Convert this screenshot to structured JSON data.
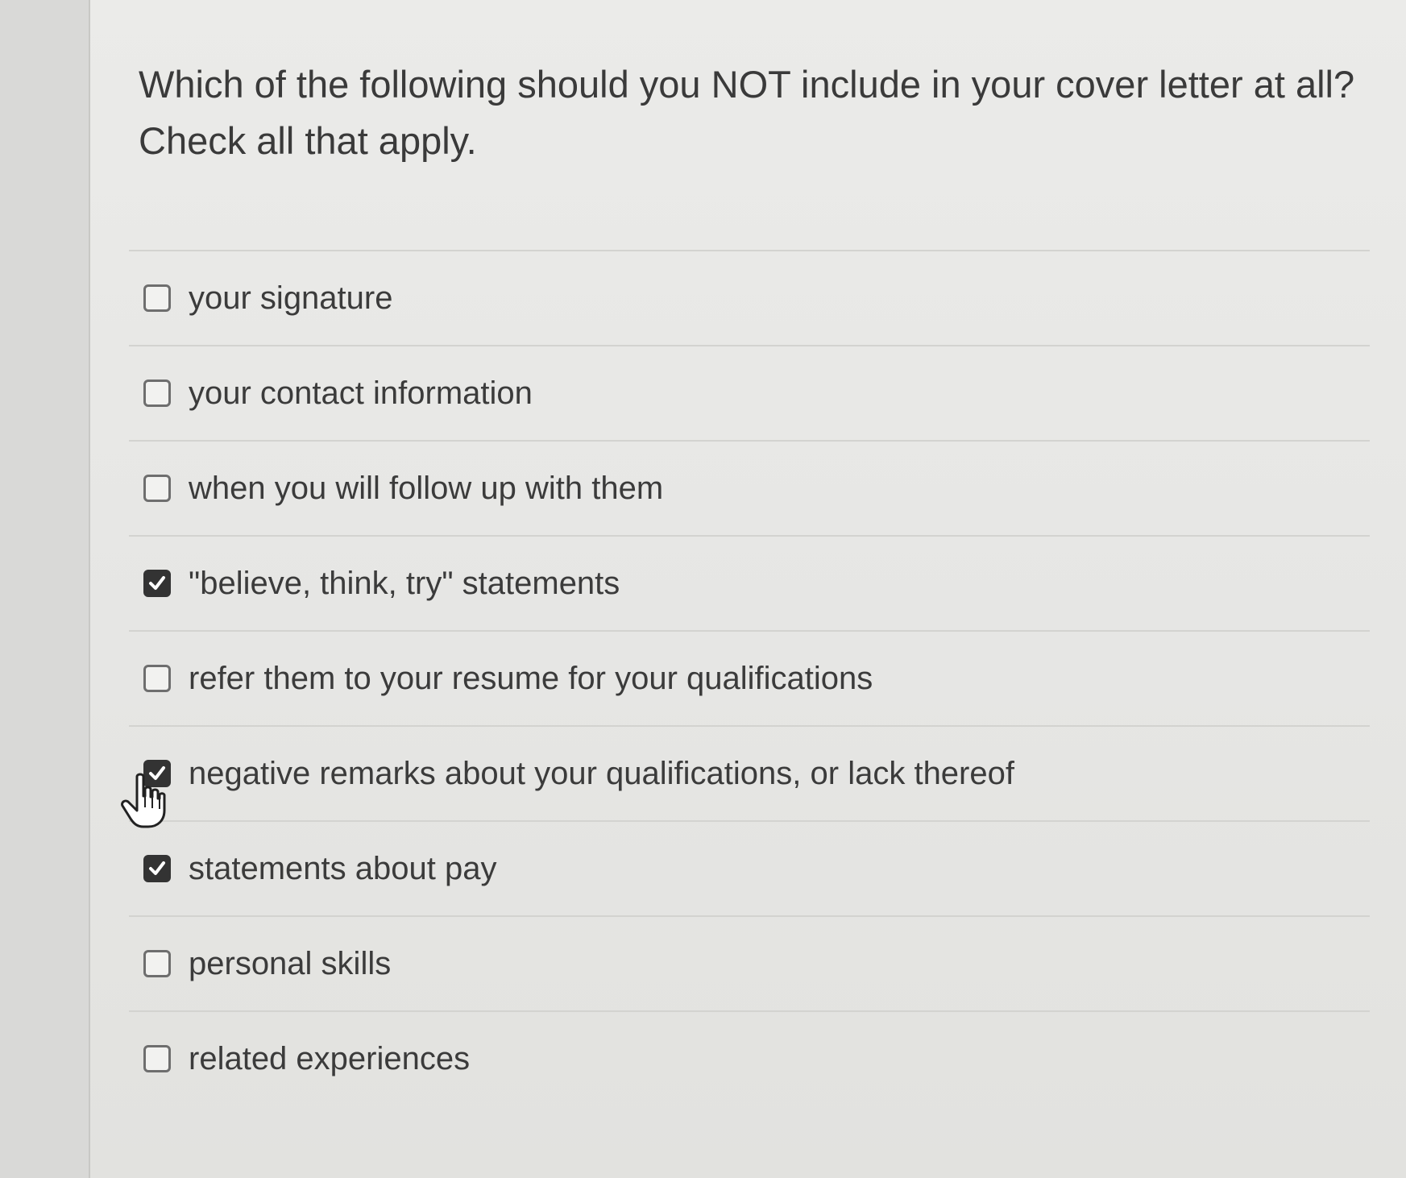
{
  "question": {
    "line1": "Which of the following should you NOT include in your cover letter at all?",
    "line2": "Check all that apply."
  },
  "options": [
    {
      "label": "your signature",
      "checked": false
    },
    {
      "label": "your contact information",
      "checked": false
    },
    {
      "label": "when you will follow up with them",
      "checked": false
    },
    {
      "label": "\"believe, think, try\" statements",
      "checked": true
    },
    {
      "label": "refer them to your resume for your qualifications",
      "checked": false
    },
    {
      "label": "negative remarks about your qualifications, or lack thereof",
      "checked": true
    },
    {
      "label": "statements about pay",
      "checked": true
    },
    {
      "label": "personal skills",
      "checked": false
    },
    {
      "label": "related experiences",
      "checked": false
    }
  ],
  "cursor_icon": "hand-pointer-icon",
  "colors": {
    "checked_fill": "#333333",
    "text": "#3b3b3b",
    "divider": "#d3d3d0"
  }
}
